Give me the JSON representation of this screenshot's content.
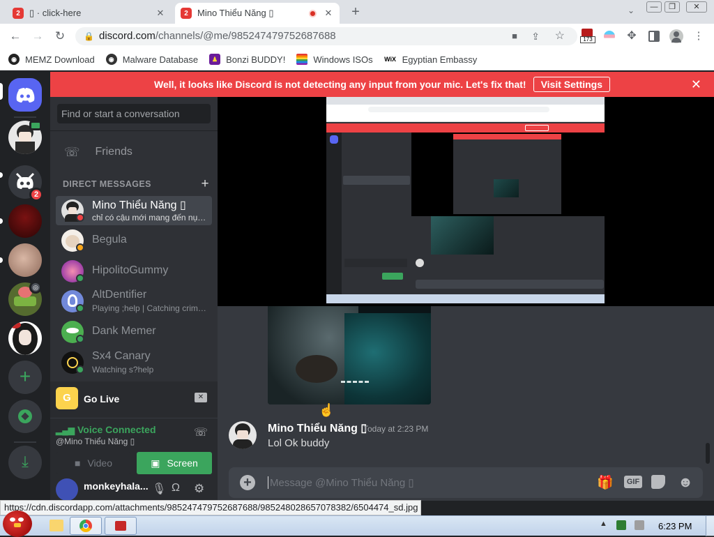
{
  "browser": {
    "tabs": [
      {
        "title": "▯ · click-here",
        "badge": "2"
      },
      {
        "title": "Mino Thiểu Năng ▯",
        "badge": "2"
      }
    ],
    "url_domain": "discord.com",
    "url_path": "/channels/@me/985247479752687688",
    "extension_badge": "173",
    "bookmarks": [
      "MEMZ Download",
      "Malware Database",
      "Bonzi BUDDY!",
      "Windows ISOs",
      "Egyptian Embassy"
    ],
    "status_url": "https://cdn.discordapp.com/attachments/985247479752687688/985248028657078382/6504474_sd.jpg"
  },
  "banner": {
    "text": "Well, it looks like Discord is not detecting any input from your mic. Let's fix that!",
    "button": "Visit Settings"
  },
  "servers": {
    "badge": "2"
  },
  "dm": {
    "search_placeholder": "Find or start a conversation",
    "friends_label": "Friends",
    "header": "DIRECT MESSAGES",
    "items": [
      {
        "name": "Mino Thiểu Năng ▯",
        "sub": "chỉ có cậu mới mang đến nụ c..."
      },
      {
        "name": "Begula",
        "sub": ""
      },
      {
        "name": "HipolitoGummy",
        "sub": ""
      },
      {
        "name": "AltDentifier",
        "sub": "Playing ;help | Catching crimin..."
      },
      {
        "name": "Dank Memer",
        "sub": ""
      },
      {
        "name": "Sx4 Canary",
        "sub": "Watching s?help"
      }
    ],
    "golive": "Go Live",
    "voice_status": "Voice Connected",
    "voice_channel": "@Mino Thiểu Năng ▯",
    "video_btn": "Video",
    "screen_btn": "Screen",
    "username": "monkeyhala..."
  },
  "chat": {
    "message_author": "Mino Thiểu Năng ▯",
    "message_time": "Today at 2:23 PM",
    "message_text": "Lol Ok buddy",
    "input_placeholder": "Message @Mino Thiểu Năng ▯",
    "gif_label": "GIF"
  },
  "taskbar": {
    "clock": "6:23 PM"
  },
  "colors": {
    "blurple": "#5865f2",
    "red": "#ed4245",
    "green": "#3ba55d",
    "bg": "#36393f"
  }
}
